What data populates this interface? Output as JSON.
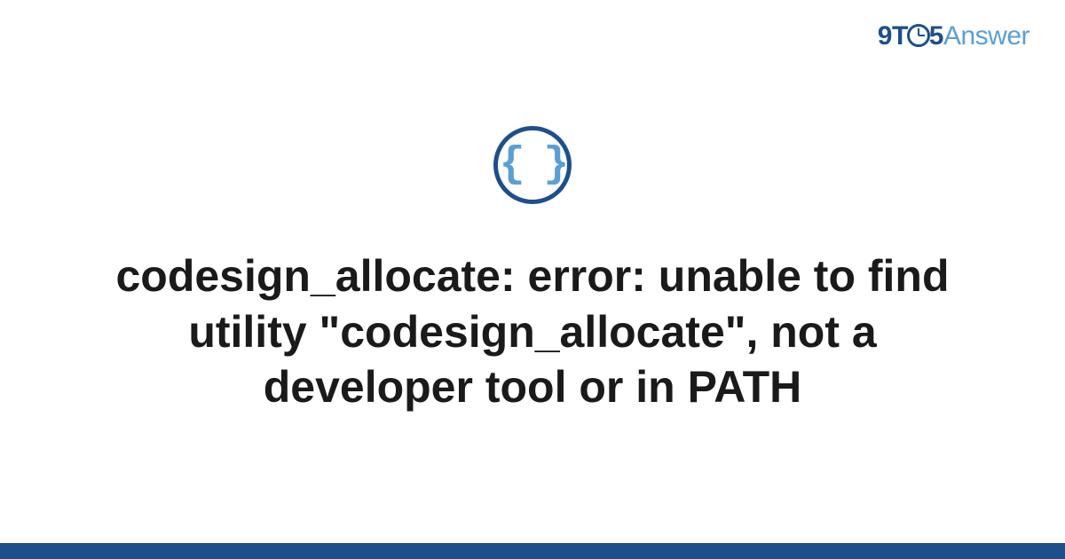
{
  "logo": {
    "nine": "9",
    "t": "T",
    "five": "5",
    "answer": "Answer"
  },
  "icon": {
    "braces": "{ }"
  },
  "title": "codesign_allocate: error: unable to find utility \"codesign_allocate\", not a developer tool or in PATH",
  "colors": {
    "primary": "#1d4f8c",
    "secondary": "#5a9fd4",
    "text": "#1a1a1a"
  }
}
